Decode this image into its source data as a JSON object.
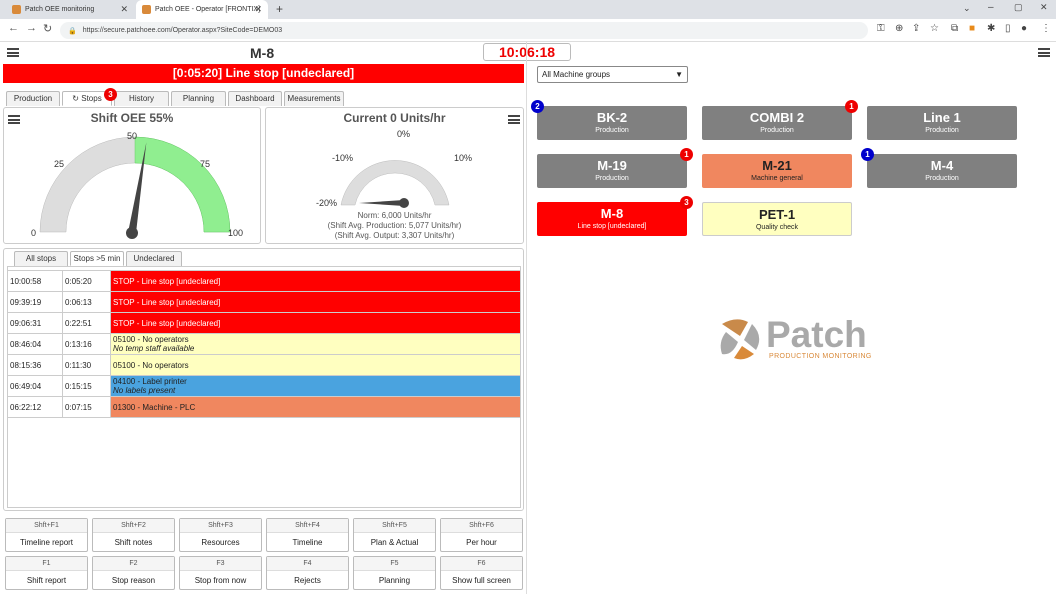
{
  "browser": {
    "tabs": [
      {
        "label": "Patch OEE monitoring",
        "active": false
      },
      {
        "label": "Patch OEE - Operator [FRONTIX]",
        "active": true
      }
    ],
    "url": "https://secure.patchoee.com/Operator.aspx?SiteCode=DEMO03"
  },
  "header": {
    "machine": "M-8",
    "clock": "10:06:18",
    "banner": "[0:05:20] Line stop [undeclared]"
  },
  "page_tabs": [
    {
      "label": "Production"
    },
    {
      "label": "Stops",
      "badge": "3",
      "selected": true
    },
    {
      "label": "History"
    },
    {
      "label": "Planning"
    },
    {
      "label": "Dashboard"
    },
    {
      "label": "Measurements"
    }
  ],
  "oee_gauge": {
    "title": "Shift OEE 55%",
    "value": 55,
    "labels": {
      "min": "0",
      "q1": "25",
      "mid": "50",
      "q3": "75",
      "max": "100"
    },
    "colors": {
      "track": "#dddddd",
      "target": "#90ee90",
      "needle": "#444444"
    }
  },
  "rate_gauge": {
    "title": "Current 0 Units/hr",
    "value": -20,
    "labels": {
      "min": "-20%",
      "low": "-10%",
      "mid": "0%",
      "high": "10%"
    },
    "notes": [
      "Norm: 6,000 Units/hr",
      "(Shift Avg. Production: 5,077 Units/hr)",
      "(Shift Avg. Output: 3,307 Units/hr)"
    ]
  },
  "stop_filter_tabs": [
    {
      "label": "All stops"
    },
    {
      "label": "Stops >5 min",
      "selected": true
    },
    {
      "label": "Undeclared"
    }
  ],
  "stops": [
    {
      "time": "10:00:58",
      "duration": "0:05:20",
      "reason": "STOP - Line stop [undeclared]",
      "note": "",
      "color": "#ff0000",
      "text_color": "#ffffff"
    },
    {
      "time": "09:39:19",
      "duration": "0:06:13",
      "reason": "STOP - Line stop [undeclared]",
      "note": "",
      "color": "#ff0000",
      "text_color": "#ffffff"
    },
    {
      "time": "09:06:31",
      "duration": "0:22:51",
      "reason": "STOP - Line stop [undeclared]",
      "note": "",
      "color": "#ff0000",
      "text_color": "#ffffff"
    },
    {
      "time": "08:46:04",
      "duration": "0:13:16",
      "reason": "05100 - No operators",
      "note": "No temp staff available",
      "color": "#ffffc0",
      "text_color": "#222222"
    },
    {
      "time": "08:15:36",
      "duration": "0:11:30",
      "reason": "05100 - No operators",
      "note": "",
      "color": "#ffffc0",
      "text_color": "#222222"
    },
    {
      "time": "06:49:04",
      "duration": "0:15:15",
      "reason": "04100 - Label printer",
      "note": "No labels present",
      "color": "#4aa3df",
      "text_color": "#222222"
    },
    {
      "time": "06:22:12",
      "duration": "0:07:15",
      "reason": "01300 - Machine - PLC",
      "note": "",
      "color": "#f0875f",
      "text_color": "#222222"
    }
  ],
  "fkeys": [
    {
      "key": "Shft+F1",
      "label": "Timeline report"
    },
    {
      "key": "Shft+F2",
      "label": "Shift notes"
    },
    {
      "key": "Shft+F3",
      "label": "Resources"
    },
    {
      "key": "Shft+F4",
      "label": "Timeline"
    },
    {
      "key": "Shft+F5",
      "label": "Plan & Actual"
    },
    {
      "key": "Shft+F6",
      "label": "Per hour"
    },
    {
      "key": "F1",
      "label": "Shift report"
    },
    {
      "key": "F2",
      "label": "Stop reason"
    },
    {
      "key": "F3",
      "label": "Stop from now"
    },
    {
      "key": "F4",
      "label": "Rejects"
    },
    {
      "key": "F5",
      "label": "Planning"
    },
    {
      "key": "F6",
      "label": "Show full screen"
    }
  ],
  "machine_group": {
    "selected": "All Machine groups"
  },
  "machines": [
    {
      "name": "BK-2",
      "status": "Production",
      "color": "#808080",
      "text": "#ffffff",
      "badge": "2",
      "badge_color": "blue",
      "badge_side": "left"
    },
    {
      "name": "COMBI 2",
      "status": "Production",
      "color": "#808080",
      "text": "#ffffff",
      "badge": "1",
      "badge_color": "red",
      "badge_side": "right"
    },
    {
      "name": "Line 1",
      "status": "Production",
      "color": "#808080",
      "text": "#ffffff",
      "badge": "",
      "badge_color": "",
      "badge_side": ""
    },
    {
      "name": "M-19",
      "status": "Production",
      "color": "#808080",
      "text": "#ffffff",
      "badge": "1",
      "badge_color": "red",
      "badge_side": "right"
    },
    {
      "name": "M-21",
      "status": "Machine general",
      "color": "#f0875f",
      "text": "#222222",
      "badge": "",
      "badge_color": "",
      "badge_side": ""
    },
    {
      "name": "M-4",
      "status": "Production",
      "color": "#808080",
      "text": "#ffffff",
      "badge": "1",
      "badge_color": "blue",
      "badge_side": "left"
    },
    {
      "name": "M-8",
      "status": "Line stop [undeclared]",
      "color": "#ff0000",
      "text": "#ffffff",
      "badge": "3",
      "badge_color": "red",
      "badge_side": "right"
    },
    {
      "name": "PET-1",
      "status": "Quality check",
      "color": "#ffffc0",
      "text": "#222222",
      "badge": "",
      "badge_color": "",
      "badge_side": ""
    }
  ],
  "logo": {
    "name": "Patch",
    "tagline": "PRODUCTION MONITORING"
  }
}
